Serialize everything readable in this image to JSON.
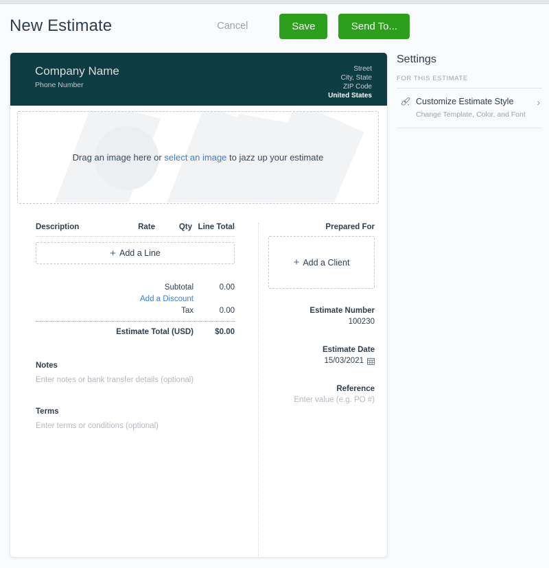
{
  "toolbar": {
    "title": "New Estimate",
    "cancel_label": "Cancel",
    "save_label": "Save",
    "send_to_label": "Send To..."
  },
  "colors": {
    "accent_green": "#2ca01c",
    "header_teal": "#0d3c42",
    "link_blue": "#3b7fd4",
    "text_dark": "#2e3e4e",
    "muted": "#9aa3ac"
  },
  "company_header": {
    "name": "Company Name",
    "phone": "Phone Number",
    "address": {
      "street": "Street",
      "city_state": "City, State",
      "zip": "ZIP Code",
      "country": "United States"
    }
  },
  "dropzone": {
    "text_before": "Drag an image here or ",
    "link": "select an image",
    "text_after": " to jazz up your estimate"
  },
  "line_items": {
    "columns": {
      "description": "Description",
      "rate": "Rate",
      "qty": "Qty",
      "line_total": "Line Total"
    },
    "rows": [],
    "add_line_label": "Add a Line"
  },
  "totals": {
    "subtotal_label": "Subtotal",
    "subtotal_value": "0.00",
    "add_discount_label": "Add a Discount",
    "tax_label": "Tax",
    "tax_value": "0.00",
    "grand_label": "Estimate Total (USD)",
    "grand_value": "$0.00"
  },
  "notes": {
    "label": "Notes",
    "placeholder": "Enter notes or bank transfer details (optional)"
  },
  "terms": {
    "label": "Terms",
    "placeholder": "Enter terms or conditions (optional)"
  },
  "prepared_for": {
    "label": "Prepared For",
    "add_client_label": "Add a Client"
  },
  "estimate_number": {
    "label": "Estimate Number",
    "value": "100230"
  },
  "estimate_date": {
    "label": "Estimate Date",
    "value": "15/03/2021"
  },
  "reference": {
    "label": "Reference",
    "placeholder": "Enter value (e.g. PO #)"
  },
  "settings": {
    "title": "Settings",
    "subtitle": "FOR THIS ESTIMATE",
    "items": [
      {
        "title": "Customize Estimate Style",
        "subtitle": "Change Template, Color, and Font",
        "icon": "paintbrush-icon",
        "chevron": "›"
      }
    ]
  }
}
